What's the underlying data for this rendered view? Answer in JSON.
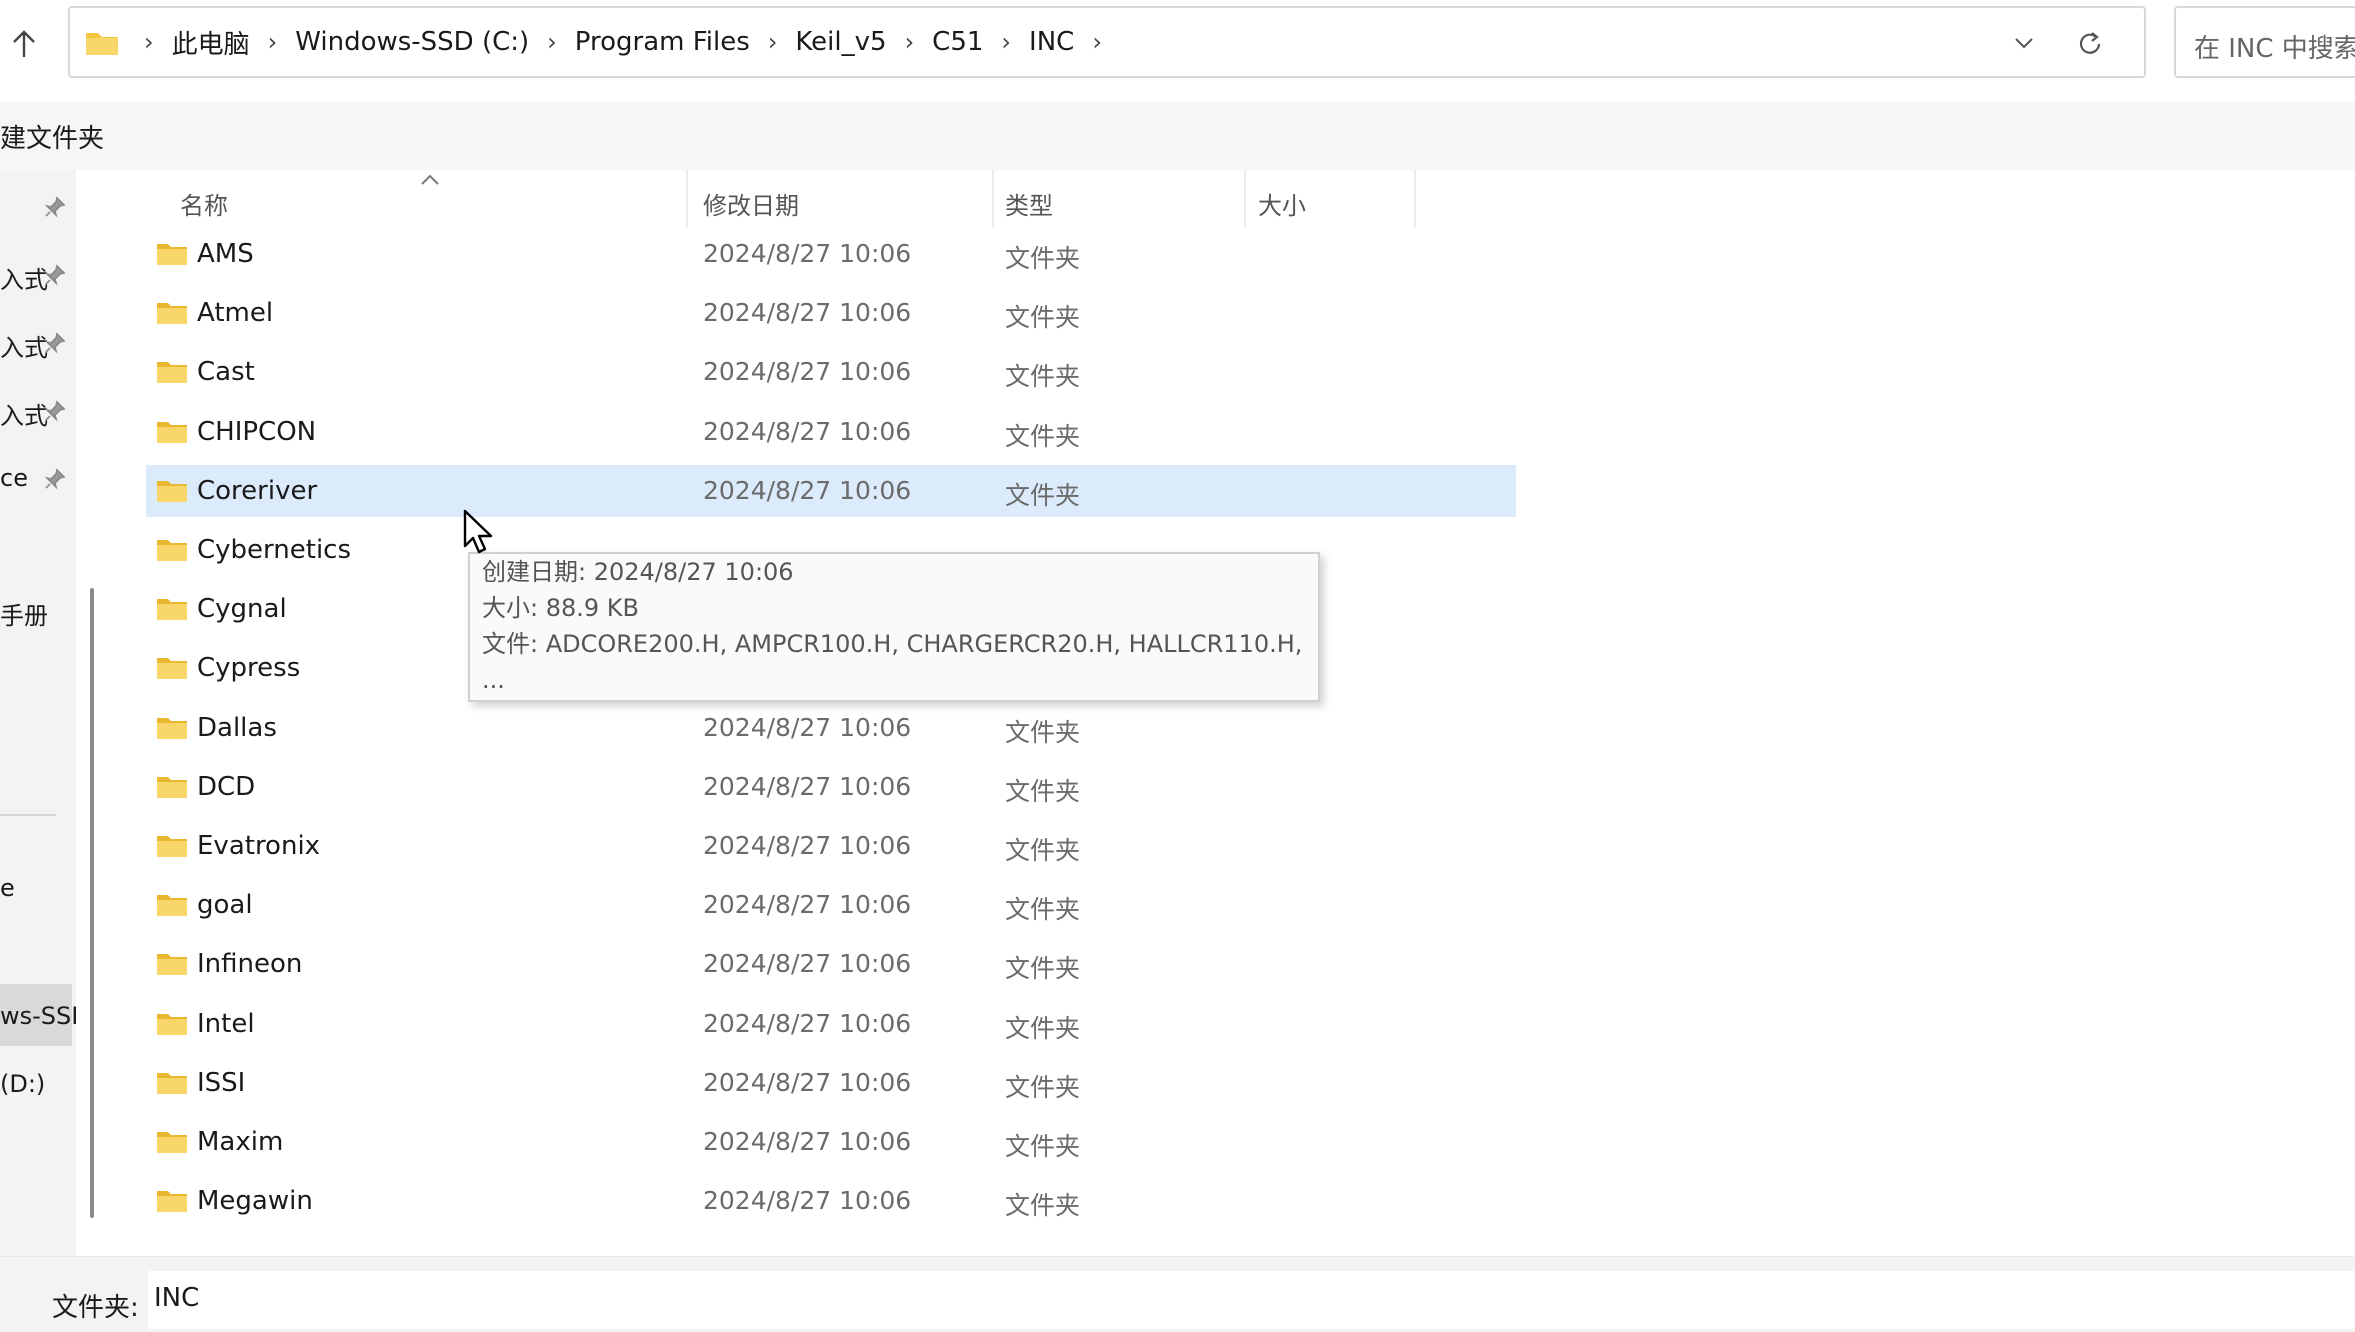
{
  "address_bar": {
    "crumbs": [
      "此电脑",
      "Windows-SSD (C:)",
      "Program Files",
      "Keil_v5",
      "C51",
      "INC"
    ]
  },
  "search": {
    "placeholder": "在 INC 中搜索"
  },
  "command_bar": {
    "new_folder_label": "建文件夹"
  },
  "sidebar": {
    "items": [
      {
        "label": "",
        "pinned": true
      },
      {
        "label": "入式",
        "pinned": true
      },
      {
        "label": "入式",
        "pinned": true
      },
      {
        "label": "入式",
        "pinned": true
      },
      {
        "label": "ce",
        "pinned": true
      },
      {
        "label": "手册",
        "pinned": false
      },
      {
        "label": "e",
        "pinned": false
      },
      {
        "label": "ws-SSD",
        "pinned": false
      },
      {
        "label": "(D:)",
        "pinned": false
      }
    ]
  },
  "columns": {
    "name": "名称",
    "date": "修改日期",
    "type": "类型",
    "size": "大小"
  },
  "rows": [
    {
      "name": "AMS",
      "date": "2024/8/27 10:06",
      "type": "文件夹"
    },
    {
      "name": "Atmel",
      "date": "2024/8/27 10:06",
      "type": "文件夹"
    },
    {
      "name": "Cast",
      "date": "2024/8/27 10:06",
      "type": "文件夹"
    },
    {
      "name": "CHIPCON",
      "date": "2024/8/27 10:06",
      "type": "文件夹"
    },
    {
      "name": "Coreriver",
      "date": "2024/8/27 10:06",
      "type": "文件夹"
    },
    {
      "name": "Cybernetics",
      "date": "",
      "type": ""
    },
    {
      "name": "Cygnal",
      "date": "",
      "type": ""
    },
    {
      "name": "Cypress",
      "date": "",
      "type": ""
    },
    {
      "name": "Dallas",
      "date": "2024/8/27 10:06",
      "type": "文件夹"
    },
    {
      "name": "DCD",
      "date": "2024/8/27 10:06",
      "type": "文件夹"
    },
    {
      "name": "Evatronix",
      "date": "2024/8/27 10:06",
      "type": "文件夹"
    },
    {
      "name": "goal",
      "date": "2024/8/27 10:06",
      "type": "文件夹"
    },
    {
      "name": "Infineon",
      "date": "2024/8/27 10:06",
      "type": "文件夹"
    },
    {
      "name": "Intel",
      "date": "2024/8/27 10:06",
      "type": "文件夹"
    },
    {
      "name": "ISSI",
      "date": "2024/8/27 10:06",
      "type": "文件夹"
    },
    {
      "name": "Maxim",
      "date": "2024/8/27 10:06",
      "type": "文件夹"
    },
    {
      "name": "Megawin",
      "date": "2024/8/27 10:06",
      "type": "文件夹"
    }
  ],
  "selected_row": "Coreriver",
  "tooltip": {
    "line1": "创建日期: 2024/8/27 10:06",
    "line2": "大小: 88.9 KB",
    "line3": "文件: ADCORE200.H, AMPCR100.H, CHARGERCR20.H, HALLCR110.H,",
    "line4": "..."
  },
  "bottom_bar": {
    "folder_label": "文件夹:",
    "folder_value": "INC"
  },
  "colors": {
    "selection": "#dcebfc",
    "folder": "#f5c542"
  }
}
